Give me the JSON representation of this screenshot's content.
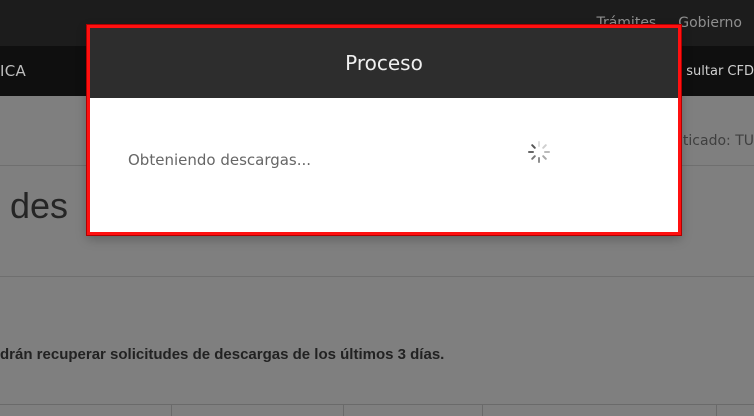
{
  "top_nav": {
    "links": [
      "Trámites",
      "Gobierno"
    ]
  },
  "second_nav": {
    "brand": "ICA",
    "right_link": "sultar CFD"
  },
  "auth": {
    "text": "nticado: TU"
  },
  "page": {
    "title": "des",
    "notice": "drán recuperar solicitudes de descargas de los últimos 3 días."
  },
  "modal": {
    "title": "Proceso",
    "status_text": "Obteniendo descargas...",
    "spinner_icon": "loading-spinner-icon",
    "border_color": "#ff1010"
  }
}
